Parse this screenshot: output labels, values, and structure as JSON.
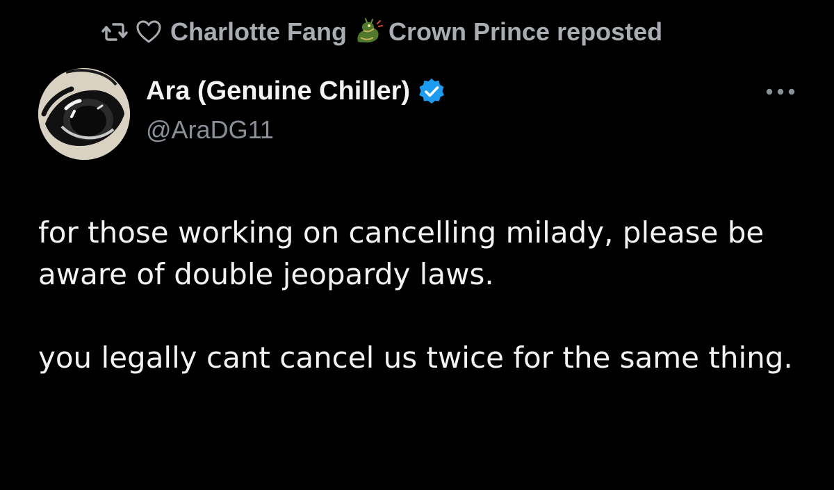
{
  "repost": {
    "reposter_name": "Charlotte Fang",
    "reposter_suffix": "Crown Prince reposted",
    "icons": [
      "repost-icon",
      "heart-icon",
      "dragon-icon"
    ]
  },
  "author": {
    "display_name": "Ara (Genuine Chiller)",
    "handle": "@AraDG11",
    "verified": true,
    "verified_color": "#1d9bf0"
  },
  "menu": {
    "more_label": "···"
  },
  "tweet": {
    "paragraphs": [
      "for those working on cancelling milady, please be aware of double jeopardy laws.",
      "you legally cant cancel us twice for the same thing."
    ]
  },
  "colors": {
    "background": "#000000",
    "primary_text": "#f2f3f4",
    "secondary_text": "#8b9096",
    "repost_text": "#a9adb2"
  }
}
